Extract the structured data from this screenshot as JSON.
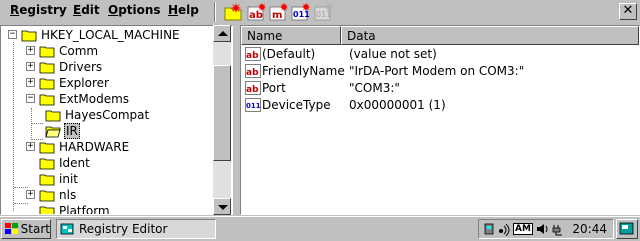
{
  "menu": {
    "registry": {
      "pre": "",
      "u": "R",
      "post": "egistry"
    },
    "edit": {
      "pre": "",
      "u": "E",
      "post": "dit"
    },
    "options": {
      "pre": "",
      "u": "O",
      "post": "ptions"
    },
    "help": {
      "pre": "",
      "u": "H",
      "post": "elp"
    }
  },
  "toolbar": {
    "close_glyph": "✕",
    "new_key_icon": "new-key-icon",
    "new_string_icon": "new-string-value-icon",
    "new_multistring_icon": "new-multistring-value-icon",
    "new_dword_icon": "new-dword-value-icon",
    "new_binary_icon": "new-binary-value-icon"
  },
  "tree": {
    "root": "HKEY_LOCAL_MACHINE",
    "comm": "Comm",
    "drivers": "Drivers",
    "explorer": "Explorer",
    "extmodems": "ExtModems",
    "hayescompat": "HayesCompat",
    "ir": "IR",
    "hardware": "HARDWARE",
    "ident": "Ident",
    "init": "init",
    "nls": "nls",
    "platform": "Platform",
    "expanded_glyph": "−",
    "collapsed_glyph": "+"
  },
  "list": {
    "col_name": "Name",
    "col_data": "Data",
    "rows": [
      {
        "icon": "ab",
        "name": "(Default)",
        "data": "(value not set)"
      },
      {
        "icon": "ab",
        "name": "FriendlyName",
        "data": "\"IrDA-Port Modem on COM3:\""
      },
      {
        "icon": "ab",
        "name": "Port",
        "data": "\"COM3:\""
      },
      {
        "icon": "dword",
        "name": "DeviceType",
        "data": "0x00000001 (1)"
      }
    ]
  },
  "taskbar": {
    "start_label": "Start",
    "task_label": "Registry Editor",
    "tray_am": "AM",
    "clock": "20:44"
  },
  "colors": {
    "folder": "#ffff00",
    "string_icon": "#c00000",
    "dword_icon": "#0000c0",
    "selection_bg": "#c0c0c0"
  }
}
